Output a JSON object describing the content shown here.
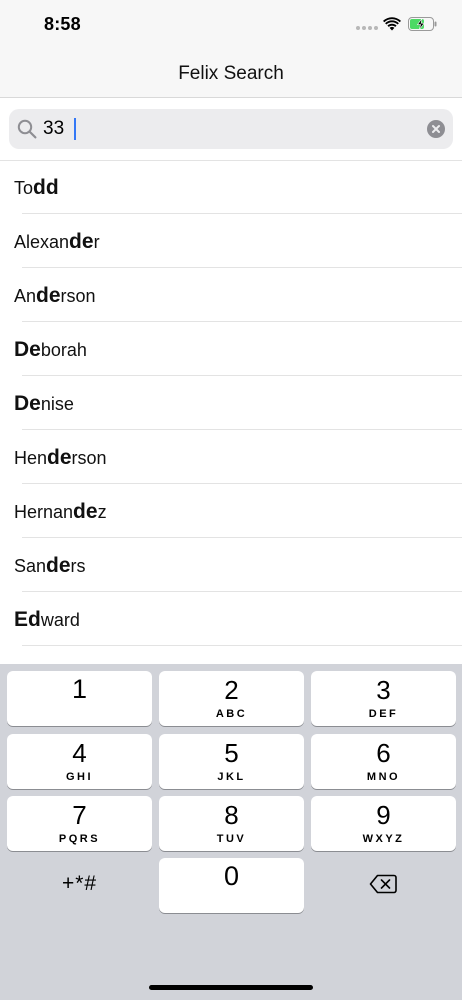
{
  "status_bar": {
    "time": "8:58",
    "icons": [
      "cellular-signal-icon",
      "wifi-icon",
      "battery-charging-icon"
    ],
    "battery_color": "#4cd964"
  },
  "nav": {
    "title": "Felix Search"
  },
  "search": {
    "value": "33",
    "icons": [
      "search-icon",
      "clear-icon"
    ],
    "caret_color": "#3478f6"
  },
  "results": [
    {
      "pre": "To",
      "hl": "dd",
      "post": ""
    },
    {
      "pre": "Alexan",
      "hl": "de",
      "post": "r"
    },
    {
      "pre": "An",
      "hl": "de",
      "post": "rson"
    },
    {
      "pre": "",
      "hl": "De",
      "post": "borah"
    },
    {
      "pre": "",
      "hl": "De",
      "post": "nise"
    },
    {
      "pre": "Hen",
      "hl": "de",
      "post": "rson"
    },
    {
      "pre": "Hernan",
      "hl": "de",
      "post": "z"
    },
    {
      "pre": "San",
      "hl": "de",
      "post": "rs"
    },
    {
      "pre": "",
      "hl": "Ed",
      "post": "ward"
    }
  ],
  "keypad": {
    "keys": [
      {
        "digit": "1",
        "letters": ""
      },
      {
        "digit": "2",
        "letters": "ABC"
      },
      {
        "digit": "3",
        "letters": "DEF"
      },
      {
        "digit": "4",
        "letters": "GHI"
      },
      {
        "digit": "5",
        "letters": "JKL"
      },
      {
        "digit": "6",
        "letters": "MNO"
      },
      {
        "digit": "7",
        "letters": "PQRS"
      },
      {
        "digit": "8",
        "letters": "TUV"
      },
      {
        "digit": "9",
        "letters": "WXYZ"
      },
      {
        "digit": "0",
        "letters": ""
      }
    ],
    "symbols_label": "+*#",
    "delete_icon": "backspace-icon",
    "background_color": "#d1d3d9"
  }
}
